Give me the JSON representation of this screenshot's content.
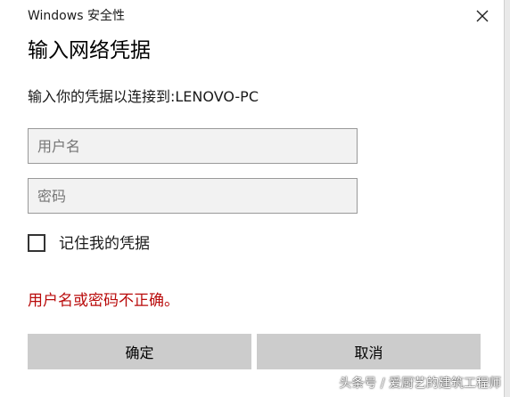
{
  "window": {
    "title": "Windows 安全性"
  },
  "dialog": {
    "heading": "输入网络凭据",
    "subtitle": "输入你的凭据以连接到:LENOVO-PC",
    "username_placeholder": "用户名",
    "password_placeholder": "密码",
    "remember_label": "记住我的凭据",
    "remember_checked": false,
    "error_message": "用户名或密码不正确。",
    "ok_label": "确定",
    "cancel_label": "取消"
  },
  "watermark": {
    "text": "头条号 / 爱厨艺的建筑工程师"
  },
  "colors": {
    "error": "#b90b0b",
    "button_bg": "#cccccc",
    "field_bg": "#f2f2f2"
  },
  "icons": {
    "close": "close-icon"
  }
}
